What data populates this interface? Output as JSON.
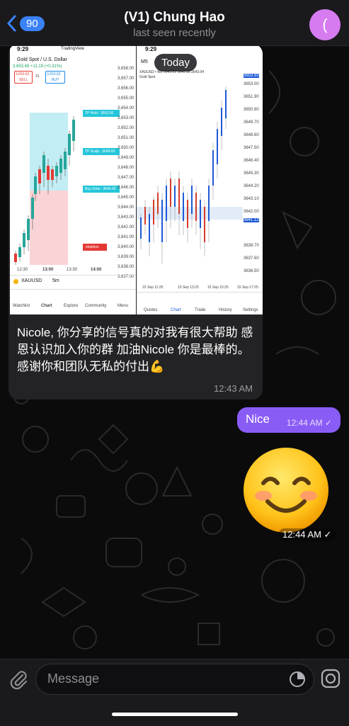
{
  "header": {
    "back_count": "90",
    "title": "(V1) Chung Hao",
    "subtitle": "last seen recently",
    "avatar_letter": "("
  },
  "date_pill": "Today",
  "messages": {
    "incoming_text": "Nicole, 你分享的信号真的对我有很大帮助 感恩认识加入你的群 加油Nicole 你是最棒的。感谢你和团队无私的付出💪",
    "incoming_time": "12:43 AM",
    "outgoing_text": "Nice",
    "outgoing_time": "12:44 AM",
    "outgoing_check": "✓",
    "emoji_time": "12:44 AM ✓"
  },
  "screenshot_left": {
    "clock": "9:29",
    "brand": "TradingView",
    "symbol": "Gold Spot / U.S. Dollar",
    "quote": "3,653.49 +11.19 (+0.31%)",
    "sell_price": "3,653.62",
    "sell_label": "SELL",
    "spread": "31",
    "buy_price": "3,653.93",
    "buy_label": "BUY",
    "tp_hold": "TP Hold : 3652.66",
    "tp_scalp": "TP Scalp : 3648.65",
    "buy_zone": "Buy Zone : 3644.65",
    "stoploss": "stoploss",
    "prices": [
      "3,658.00",
      "3,657.00",
      "3,656.00",
      "3,655.00",
      "3,654.00",
      "3,653.00",
      "3,652.00",
      "3,651.00",
      "3,650.00",
      "3,649.00",
      "3,648.00",
      "3,647.00",
      "3,646.00",
      "3,645.00",
      "3,644.00",
      "3,643.00",
      "3,642.00",
      "3,641.00",
      "3,640.00",
      "3,639.00",
      "3,638.00",
      "3,637.00"
    ],
    "times": [
      "12:30",
      "13:00",
      "13:30",
      "14:00"
    ],
    "ticker": "XAUUSD",
    "interval": "5m",
    "tabs": [
      "Watchlist",
      "Chart",
      "Explore",
      "Community",
      "Menu"
    ]
  },
  "screenshot_right": {
    "clock": "9:29",
    "tf": "M5",
    "symbol_line": "XAUUSD • M5",
    "ohlc": "3643.01 3640.38 3643.04",
    "name": "Gold Spot",
    "prices": [
      "3653.93",
      "3653.00",
      "3651.90",
      "3650.80",
      "3649.70",
      "3648.60",
      "3647.50",
      "3646.40",
      "3645.30",
      "3644.20",
      "3643.10",
      "3642.00",
      "3641.12",
      "3638.70",
      "3637.60",
      "3636.50"
    ],
    "times": [
      "15 Sep 11:25",
      "15 Sep 13:25",
      "15 Sep 15:25",
      "15 Sep 17:25"
    ],
    "tabs": [
      "Quotes",
      "Chart",
      "Trade",
      "History",
      "Settings"
    ]
  },
  "composer": {
    "placeholder": "Message"
  },
  "colors": {
    "outgoing_bubble": "#8a5cf6",
    "incoming_bubble": "#232326",
    "accent": "#3b82f6",
    "avatar": "#d77bf0"
  }
}
